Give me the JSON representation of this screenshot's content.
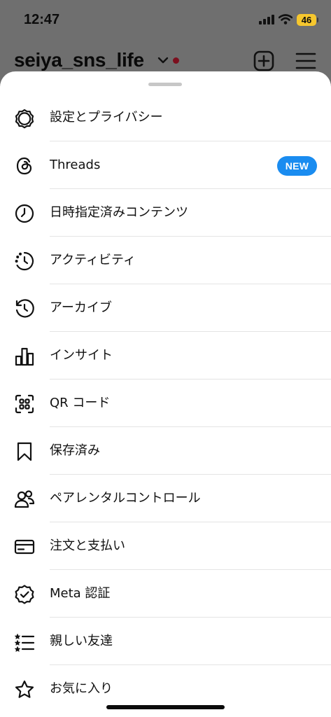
{
  "status_bar": {
    "time": "12:47",
    "battery": "46"
  },
  "header": {
    "username": "seiya_sns_life"
  },
  "menu": {
    "items": [
      {
        "id": "settings",
        "label": "設定とプライバシー",
        "icon": "gear-icon"
      },
      {
        "id": "threads",
        "label": "Threads",
        "icon": "threads-icon",
        "badge": "NEW"
      },
      {
        "id": "scheduled",
        "label": "日時指定済みコンテンツ",
        "icon": "clock-icon"
      },
      {
        "id": "activity",
        "label": "アクティビティ",
        "icon": "activity-icon"
      },
      {
        "id": "archive",
        "label": "アーカイブ",
        "icon": "archive-icon"
      },
      {
        "id": "insights",
        "label": "インサイト",
        "icon": "insights-icon"
      },
      {
        "id": "qr",
        "label": "QR コード",
        "icon": "qr-code-icon"
      },
      {
        "id": "saved",
        "label": "保存済み",
        "icon": "bookmark-icon"
      },
      {
        "id": "parental",
        "label": "ペアレンタルコントロール",
        "icon": "people-icon"
      },
      {
        "id": "orders",
        "label": "注文と支払い",
        "icon": "credit-card-icon"
      },
      {
        "id": "meta-verified",
        "label": "Meta 認証",
        "icon": "verified-badge-icon"
      },
      {
        "id": "close-friends",
        "label": "親しい友達",
        "icon": "star-list-icon"
      },
      {
        "id": "favorites",
        "label": "お気に入り",
        "icon": "star-icon"
      }
    ]
  },
  "colors": {
    "badge": "#1a8cf0",
    "notification_dot": "#7c0f1e",
    "battery": "#f6c72e"
  }
}
